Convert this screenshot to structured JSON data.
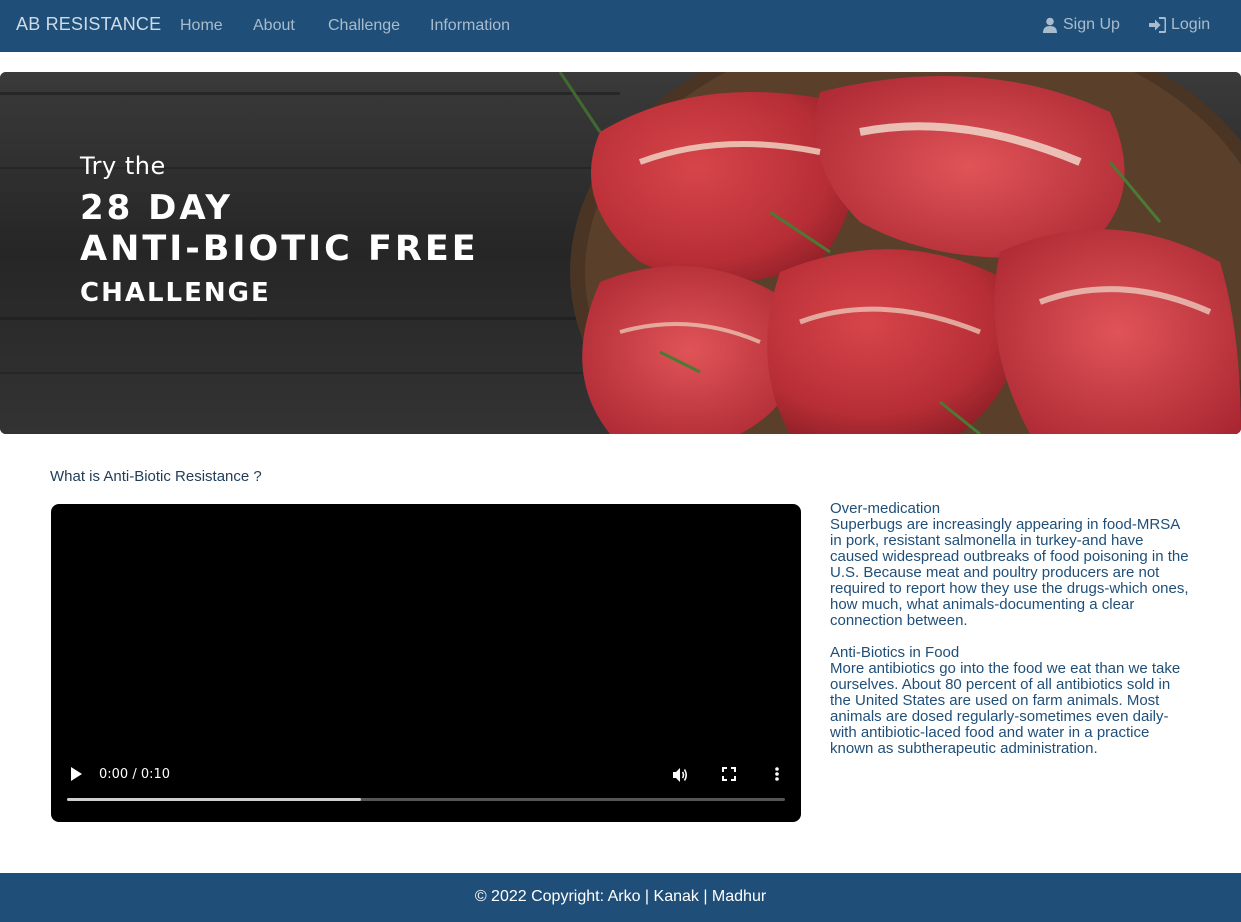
{
  "nav": {
    "brand": "AB RESISTANCE",
    "links": [
      "Home",
      "About",
      "Challenge",
      "Information"
    ],
    "signup": "Sign Up",
    "login": "Login"
  },
  "hero": {
    "line1": "Try the",
    "line2": "28 DAY",
    "line3": "ANTI-BIOTIC FREE",
    "line4": "CHALLENGE"
  },
  "main": {
    "question": "What is Anti-Biotic Resistance ?",
    "video": {
      "time": "0:00 / 0:10",
      "progress": 0.41
    },
    "sections": [
      {
        "title": "Over-medication",
        "body": "Superbugs are increasingly appearing in food-MRSA in pork, resistant salmonella in turkey-and have caused widespread outbreaks of food poisoning in the U.S. Because meat and poultry producers are not required to report how they use the drugs-which ones, how much, what animals-documenting a clear connection between."
      },
      {
        "title": "Anti-Biotics in Food",
        "body": "More antibiotics go into the food we eat than we take ourselves. About 80 percent of all antibiotics sold in the United States are used on farm animals. Most animals are dosed regularly-sometimes even daily-with antibiotic-laced food and water in a practice known as subtherapeutic administration."
      }
    ]
  },
  "footer": {
    "text": "© 2022 Copyright: Arko | Kanak | Madhur"
  },
  "colors": {
    "navbar": "#1f4f78",
    "nav_text": "#a8bccd",
    "footer": "#1f4f78"
  }
}
